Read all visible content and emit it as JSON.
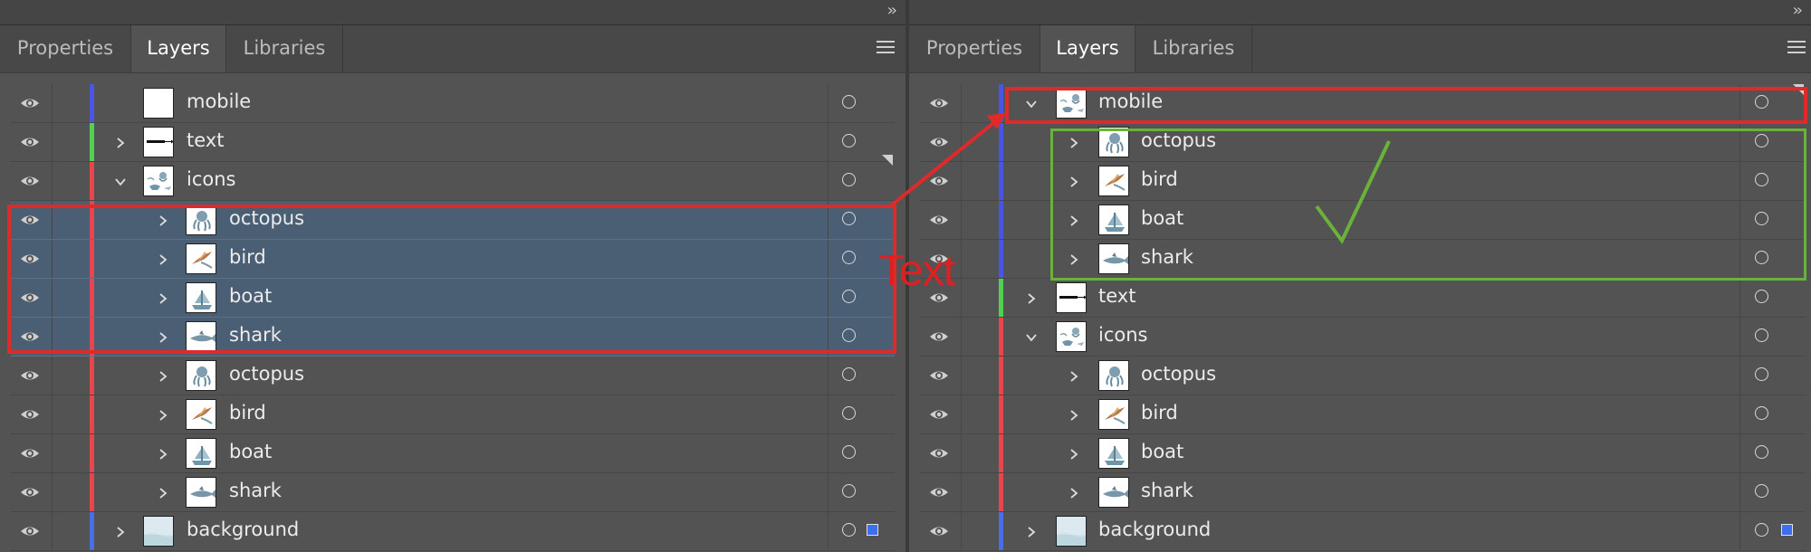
{
  "panels": {
    "left": {
      "tabs": [
        "Properties",
        "Layers",
        "Libraries"
      ],
      "active_tab": "Layers",
      "layers": [
        {
          "name": "mobile",
          "color": "#4a55e6",
          "indent": 0,
          "expander": "none",
          "thumb": "blank",
          "selected": false
        },
        {
          "name": "text",
          "color": "#52d052",
          "indent": 0,
          "expander": "collapsed",
          "thumb": "text",
          "selected": false
        },
        {
          "name": "icons",
          "color": "#e8454f",
          "indent": 0,
          "expander": "expanded",
          "thumb": "icons",
          "selected": false,
          "corner": true
        },
        {
          "name": "octopus",
          "color": "#e8454f",
          "indent": 1,
          "expander": "collapsed",
          "thumb": "octopus",
          "selected": true
        },
        {
          "name": "bird",
          "color": "#e8454f",
          "indent": 1,
          "expander": "collapsed",
          "thumb": "bird",
          "selected": true
        },
        {
          "name": "boat",
          "color": "#e8454f",
          "indent": 1,
          "expander": "collapsed",
          "thumb": "boat",
          "selected": true
        },
        {
          "name": "shark",
          "color": "#e8454f",
          "indent": 1,
          "expander": "collapsed",
          "thumb": "shark",
          "selected": true
        },
        {
          "name": "octopus",
          "color": "#e8454f",
          "indent": 1,
          "expander": "collapsed",
          "thumb": "octopus",
          "selected": false
        },
        {
          "name": "bird",
          "color": "#e8454f",
          "indent": 1,
          "expander": "collapsed",
          "thumb": "bird",
          "selected": false
        },
        {
          "name": "boat",
          "color": "#e8454f",
          "indent": 1,
          "expander": "collapsed",
          "thumb": "boat",
          "selected": false
        },
        {
          "name": "shark",
          "color": "#e8454f",
          "indent": 1,
          "expander": "collapsed",
          "thumb": "shark",
          "selected": false
        },
        {
          "name": "background",
          "color": "#4a6ee8",
          "indent": 0,
          "expander": "collapsed",
          "thumb": "background",
          "selected": false,
          "selection_square": true
        }
      ]
    },
    "right": {
      "tabs": [
        "Properties",
        "Layers",
        "Libraries"
      ],
      "active_tab": "Layers",
      "layers": [
        {
          "name": "mobile",
          "color": "#4a55e6",
          "indent": 0,
          "expander": "expanded",
          "thumb": "icons",
          "selected": false,
          "corner": true
        },
        {
          "name": "octopus",
          "color": "#4a55e6",
          "indent": 1,
          "expander": "collapsed",
          "thumb": "octopus",
          "selected": false
        },
        {
          "name": "bird",
          "color": "#4a55e6",
          "indent": 1,
          "expander": "collapsed",
          "thumb": "bird",
          "selected": false
        },
        {
          "name": "boat",
          "color": "#4a55e6",
          "indent": 1,
          "expander": "collapsed",
          "thumb": "boat",
          "selected": false
        },
        {
          "name": "shark",
          "color": "#4a55e6",
          "indent": 1,
          "expander": "collapsed",
          "thumb": "shark",
          "selected": false
        },
        {
          "name": "text",
          "color": "#52d052",
          "indent": 0,
          "expander": "collapsed",
          "thumb": "text",
          "selected": false
        },
        {
          "name": "icons",
          "color": "#e8454f",
          "indent": 0,
          "expander": "expanded",
          "thumb": "icons",
          "selected": false
        },
        {
          "name": "octopus",
          "color": "#e8454f",
          "indent": 1,
          "expander": "collapsed",
          "thumb": "octopus",
          "selected": false
        },
        {
          "name": "bird",
          "color": "#e8454f",
          "indent": 1,
          "expander": "collapsed",
          "thumb": "bird",
          "selected": false
        },
        {
          "name": "boat",
          "color": "#e8454f",
          "indent": 1,
          "expander": "collapsed",
          "thumb": "boat",
          "selected": false
        },
        {
          "name": "shark",
          "color": "#e8454f",
          "indent": 1,
          "expander": "collapsed",
          "thumb": "shark",
          "selected": false
        },
        {
          "name": "background",
          "color": "#4a6ee8",
          "indent": 0,
          "expander": "collapsed",
          "thumb": "background",
          "selected": false,
          "selection_square": true
        }
      ]
    }
  },
  "annotations": {
    "label": "Text",
    "highlight_color": "#e02a2a",
    "check_color": "#6ab23a"
  },
  "icons": {
    "visibility": "eye-icon",
    "expand": "chevron-right-icon",
    "collapse": "chevron-down-icon",
    "target": "target-circle-icon",
    "menu": "hamburger-menu-icon",
    "collapse_panel": "double-chevron-right-icon"
  }
}
